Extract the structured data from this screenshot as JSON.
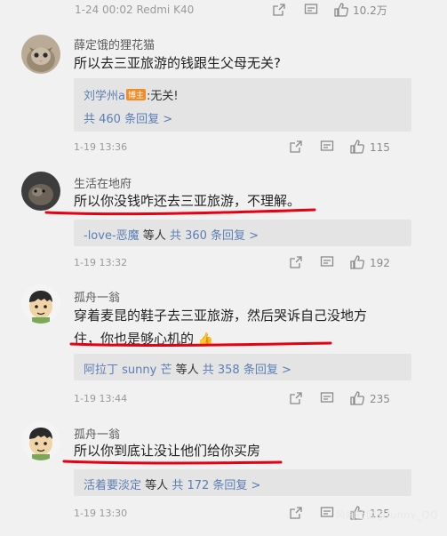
{
  "top": {
    "timestamp": "1-24 00:02 Redmi K40",
    "like_count": "10.2万"
  },
  "comments": [
    {
      "username": "薛定饿的狸花猫",
      "text": "所以去三亚旅游的钱跟生父母无关?",
      "reply_author": "刘学州a",
      "reply_badge": "博主",
      "reply_text": ":无关!",
      "reply_total": "共 460 条回复 >",
      "timestamp": "1-19 13:36",
      "like_count": "115"
    },
    {
      "username": "生活在地府",
      "text": "所以你没钱咋还去三亚旅游，不理解。",
      "reply_authors": "-love-恶魔",
      "reply_summary": "等人",
      "reply_total": "共 360 条回复 >",
      "timestamp": "1-19 13:32",
      "like_count": "192"
    },
    {
      "username": "孤舟一翁",
      "text_line1": "穿着麦昆的鞋子去三亚旅游，然后哭诉自己没地方",
      "text_line2": "住，你也是够心机的",
      "reply_authors": "阿拉丁 sunny 芒",
      "reply_summary": "等人",
      "reply_total": "共 358 条回复 >",
      "timestamp": "1-19 13:44",
      "like_count": "235"
    },
    {
      "username": "孤舟一翁",
      "text": "所以你到底让没让他们给你买房",
      "reply_authors": "活着要淡定",
      "reply_summary": "等人",
      "reply_total": "共 172 条回复 >",
      "timestamp": "1-19 13:30",
      "like_count": "125"
    }
  ],
  "watermark": "风闻社区@funny_QQ",
  "colors": {
    "link": "#5b7fb4",
    "underline": "#e60012",
    "background": "#f1f1f1"
  }
}
